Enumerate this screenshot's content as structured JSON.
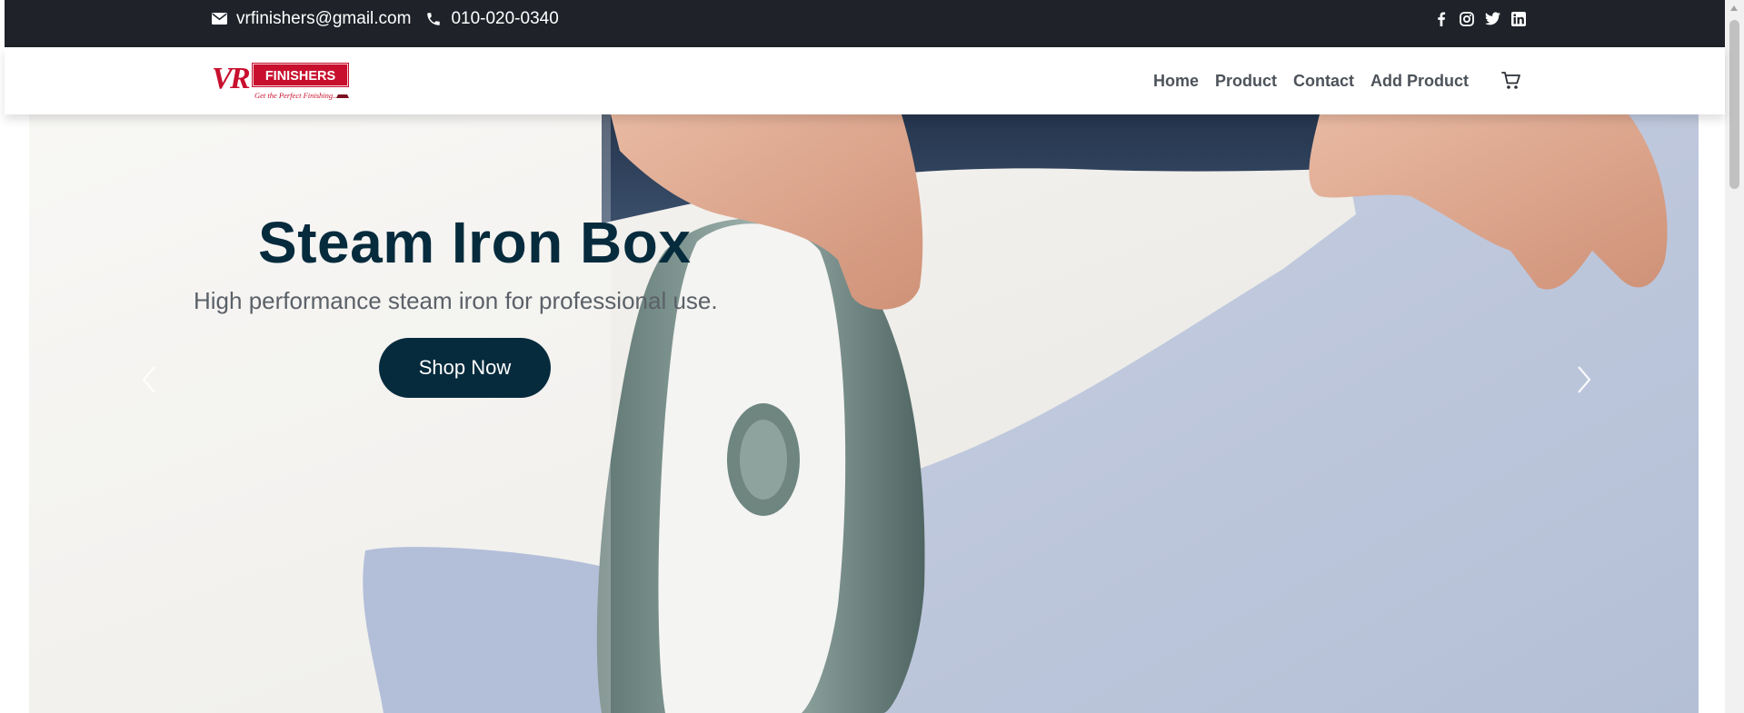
{
  "topbar": {
    "email": "vrfinishers@gmail.com",
    "phone": "010-020-0340",
    "icons": [
      "envelope-icon",
      "phone-icon",
      "facebook-icon",
      "instagram-icon",
      "twitter-icon",
      "linkedin-icon"
    ]
  },
  "brand": {
    "logo_mark": "VR",
    "logo_name": "FINISHERS",
    "tagline": "Get the Perfect Finishing...",
    "colors": {
      "red": "#c8102e",
      "dark": "#1f2329"
    }
  },
  "nav": {
    "items": [
      "Home",
      "Product",
      "Contact",
      "Add Product"
    ],
    "cart_icon": "cart-icon"
  },
  "hero": {
    "title": "Steam Iron Box",
    "subtitle": "High performance steam iron for professional use.",
    "button": "Shop Now",
    "prev_icon": "chevron-left-icon",
    "next_icon": "chevron-right-icon",
    "colors": {
      "title": "#062b3d",
      "button_bg": "#062b3d"
    }
  }
}
